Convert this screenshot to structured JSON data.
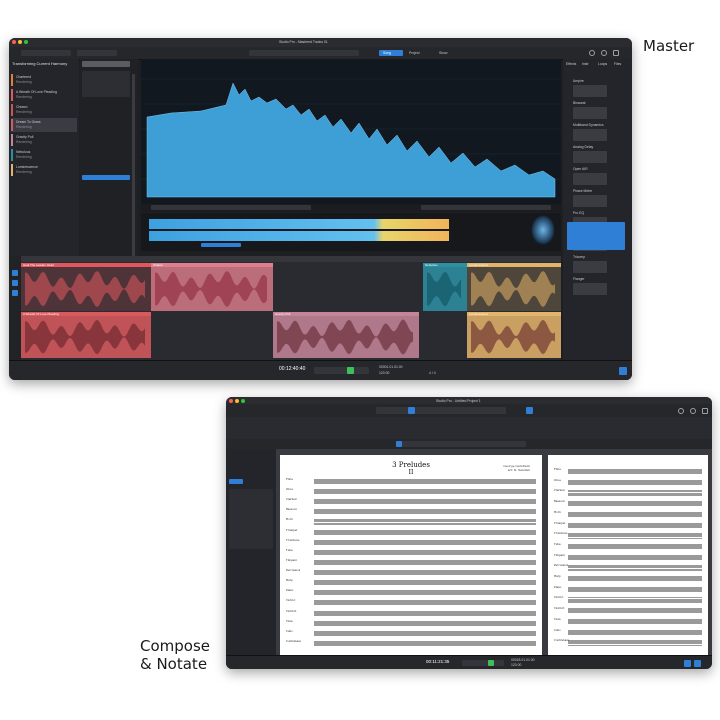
{
  "labels": {
    "master": "Master",
    "compose": "Compose",
    "notate": "& Notate"
  },
  "master_window": {
    "title": "Studio Pro - Mastered Tracks 01",
    "tabs": [
      "Song",
      "Project",
      "Show"
    ],
    "left_panel": {
      "title": "Transforming Current Harmony",
      "tracks": [
        {
          "name": "Chartered",
          "sub": "Rendering"
        },
        {
          "name": "A Wreath Of Love Pleading",
          "sub": "Rendering"
        },
        {
          "name": "Chiasm",
          "sub": "Rendering"
        },
        {
          "name": "Dream To Grass",
          "sub": "Rendering"
        },
        {
          "name": "Gravity Pull",
          "sub": "Rendering"
        },
        {
          "name": "Nebulous",
          "sub": "Rendering"
        },
        {
          "name": "Luminescence",
          "sub": "Rendering"
        }
      ],
      "selected_track": "Dream To Grass"
    },
    "browser_panel": {
      "tabs": [
        "Effects",
        "Instr",
        "Loops",
        "Files"
      ],
      "items": [
        "Ampire",
        "Binaural",
        "Multiband Dynamics",
        "Analog Delay",
        "Open AIR",
        "Phase Meter",
        "Pro EQ",
        "Spectrum Meter",
        "Tricomp",
        "Flanger"
      ]
    },
    "clips_top": [
      {
        "name": "Heal The Leaden Heart",
        "color": "#e0585e"
      },
      {
        "name": "Chiasm",
        "color": "#e07e8d"
      },
      {
        "name": "Nebulous",
        "color": "#2d8fa3"
      },
      {
        "name": "Luminescence",
        "color": "#e2b36a"
      }
    ],
    "clips_bottom": [
      {
        "name": "A Wreath Of Love Pleading",
        "color": "#d85a5d"
      },
      {
        "name": "Gravity Pull",
        "color": "#c58599"
      },
      {
        "name": "Luminescence",
        "color": "#e2b36a"
      }
    ],
    "transport": {
      "time": "00:12:40:40",
      "bars": "00001.01.01.00",
      "tempo": "120.00",
      "sig": "4 / 4"
    },
    "spectrum_color": "#3d9fd6",
    "accent": "#2f7fd6"
  },
  "compose_window": {
    "title": "Studio Pro - Untitled Project 1",
    "score": {
      "title": "3 Preludes",
      "subtitle": "II",
      "composer": "George Gershwin",
      "arranger": "arr. D. Sandler"
    },
    "instruments": [
      "Flute",
      "Oboe",
      "Clarinet",
      "Bassoon",
      "Horn",
      "Trumpet",
      "Trombone",
      "Tuba",
      "Timpani",
      "Percussion",
      "Harp",
      "Piano",
      "Violin I",
      "Violin II",
      "Viola",
      "Cello",
      "Contrabass"
    ],
    "transport": {
      "time": "00:11:21:35",
      "bars": "00018.01.01.00",
      "tempo": "120.00"
    }
  }
}
